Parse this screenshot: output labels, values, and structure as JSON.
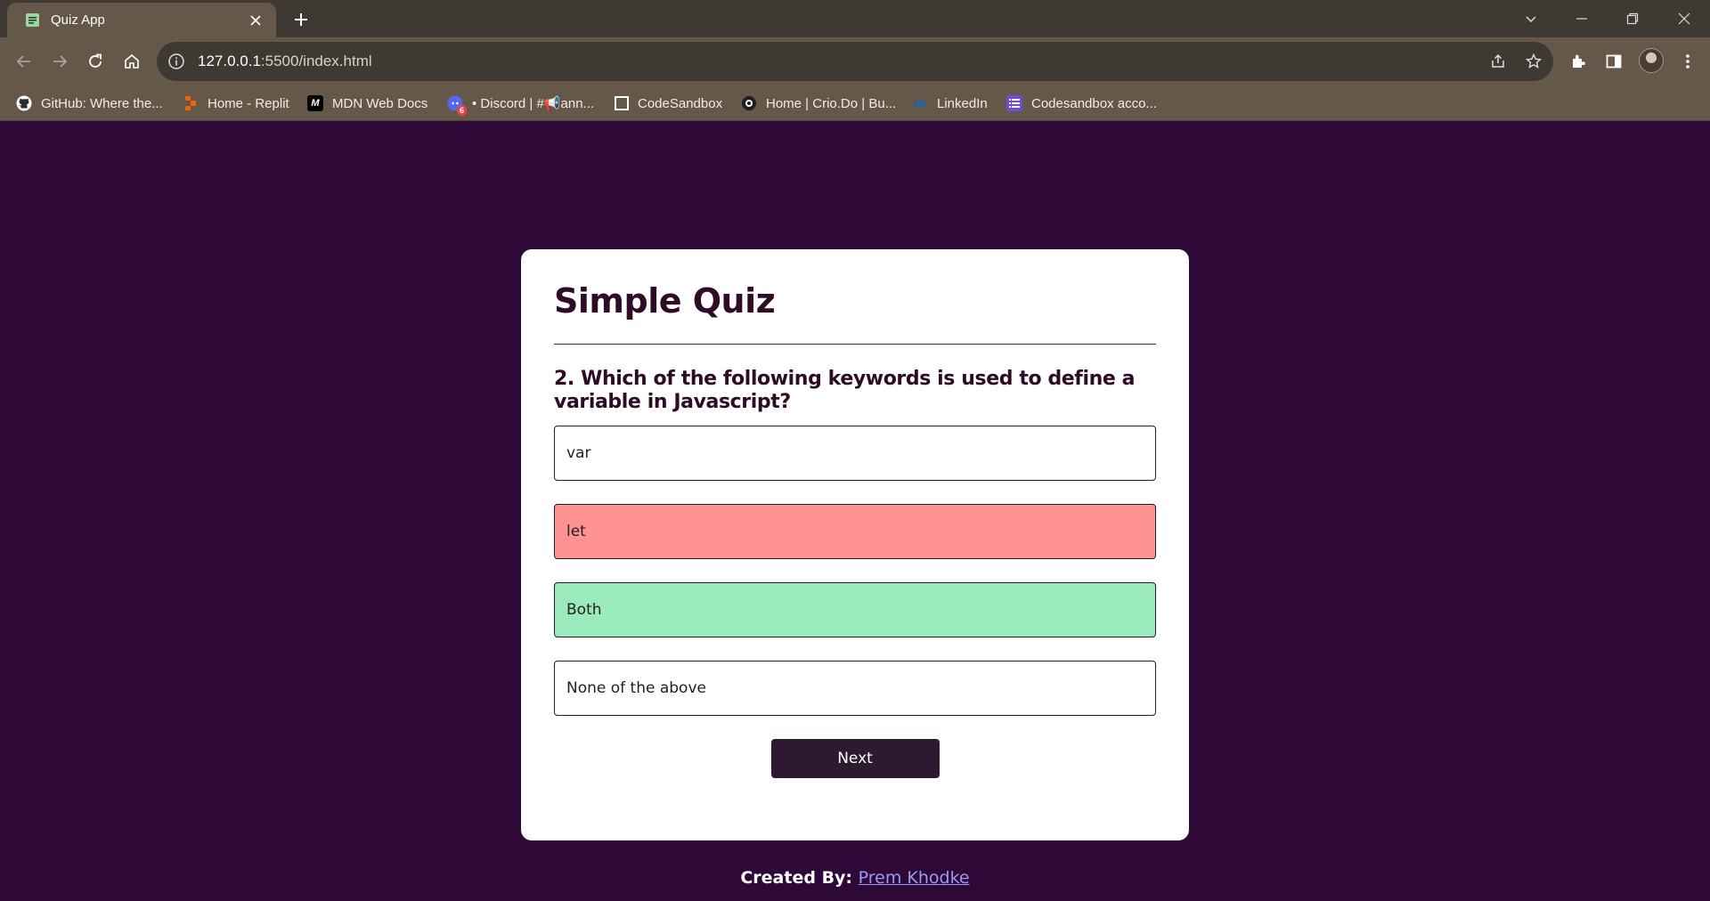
{
  "browser": {
    "tab_title": "Quiz App",
    "url_host": "127.0.0.1",
    "url_rest": ":5500/index.html",
    "bookmarks": [
      {
        "label": "GitHub: Where the...",
        "icon": "github-icon"
      },
      {
        "label": "Home - Replit",
        "icon": "replit-icon"
      },
      {
        "label": "MDN Web Docs",
        "icon": "mdn-icon"
      },
      {
        "label": "• Discord | #📢ann...",
        "icon": "discord-icon",
        "badge": "6"
      },
      {
        "label": "CodeSandbox",
        "icon": "codesandbox-icon"
      },
      {
        "label": "Home | Crio.Do | Bu...",
        "icon": "crio-icon"
      },
      {
        "label": "LinkedIn",
        "icon": "linkedin-icon"
      },
      {
        "label": "Codesandbox acco...",
        "icon": "codesandbox-account-icon"
      }
    ]
  },
  "quiz": {
    "title": "Simple Quiz",
    "question": "2. Which of the following keywords is used to define a variable in Javascript?",
    "answers": [
      {
        "text": "var",
        "state": "neutral"
      },
      {
        "text": "let",
        "state": "incorrect"
      },
      {
        "text": "Both",
        "state": "correct"
      },
      {
        "text": "None of the above",
        "state": "neutral"
      }
    ],
    "next_label": "Next"
  },
  "footer": {
    "prefix": "Created By: ",
    "author": "Prem Khodke"
  },
  "colors": {
    "page_bg": "#2e0836",
    "incorrect": "#ff9393",
    "correct": "#9aeabc",
    "button": "#2e1a30",
    "link": "#9a9bf5"
  }
}
